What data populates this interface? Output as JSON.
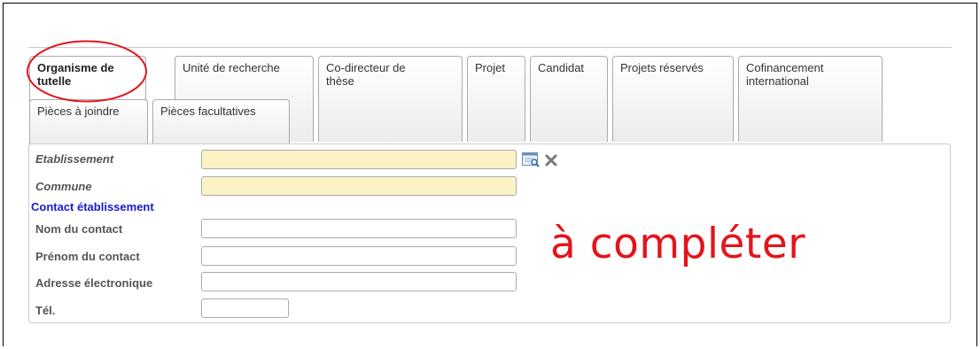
{
  "tabs_row1": [
    {
      "label": "Organisme de\ntutelle",
      "active": true
    },
    {
      "label": "Unité de recherche",
      "active": false
    },
    {
      "label": "Co-directeur de\nthèse",
      "active": false
    },
    {
      "label": "Projet",
      "active": false
    },
    {
      "label": "Candidat",
      "active": false
    },
    {
      "label": "Projets réservés",
      "active": false
    },
    {
      "label": "Cofinancement\ninternational",
      "active": false
    }
  ],
  "tabs_row2": [
    {
      "label": "Pièces à joindre",
      "active": false
    },
    {
      "label": "Pièces facultatives",
      "active": false
    }
  ],
  "form": {
    "etablissement": {
      "label": "Etablissement",
      "value": "",
      "required": true
    },
    "commune": {
      "label": "Commune",
      "value": "",
      "required": true
    },
    "contact_section_title": "Contact établissement",
    "nom_contact": {
      "label": "Nom du contact",
      "value": ""
    },
    "prenom_contact": {
      "label": "Prénom du contact",
      "value": ""
    },
    "adresse_electronique": {
      "label": "Adresse électronique",
      "value": ""
    },
    "tel": {
      "label": "Tél.",
      "value": ""
    }
  },
  "icons": {
    "lookup": "search-list-icon",
    "clear": "close-icon"
  },
  "annotation": {
    "text": "à compléter",
    "color": "#e3141b"
  },
  "colors": {
    "required_field_bg": "#fdf1c6",
    "section_title": "#1a1ad0",
    "highlight_ellipse": "#e3141b"
  }
}
